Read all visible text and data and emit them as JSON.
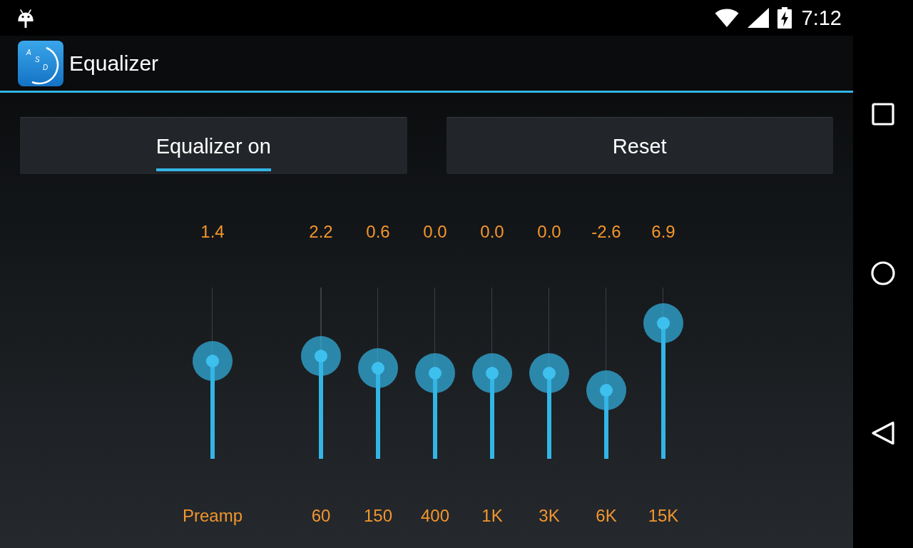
{
  "status_bar": {
    "time": "7:12"
  },
  "app_bar": {
    "logo_letters": [
      "A",
      "S",
      "D"
    ],
    "title": "Equalizer"
  },
  "toggle": {
    "label": "Equalizer on",
    "on": true
  },
  "reset_button": {
    "label": "Reset"
  },
  "preamp": {
    "value": "1.4",
    "level": 0.57,
    "label": "Preamp"
  },
  "bands": [
    {
      "value": "2.2",
      "level": 0.6,
      "label": "60"
    },
    {
      "value": "0.6",
      "level": 0.53,
      "label": "150"
    },
    {
      "value": "0.0",
      "level": 0.5,
      "label": "400"
    },
    {
      "value": "0.0",
      "level": 0.5,
      "label": "1K"
    },
    {
      "value": "0.0",
      "level": 0.5,
      "label": "3K"
    },
    {
      "value": "-2.6",
      "level": 0.4,
      "label": "6K"
    },
    {
      "value": "6.9",
      "level": 0.79,
      "label": "15K"
    }
  ]
}
